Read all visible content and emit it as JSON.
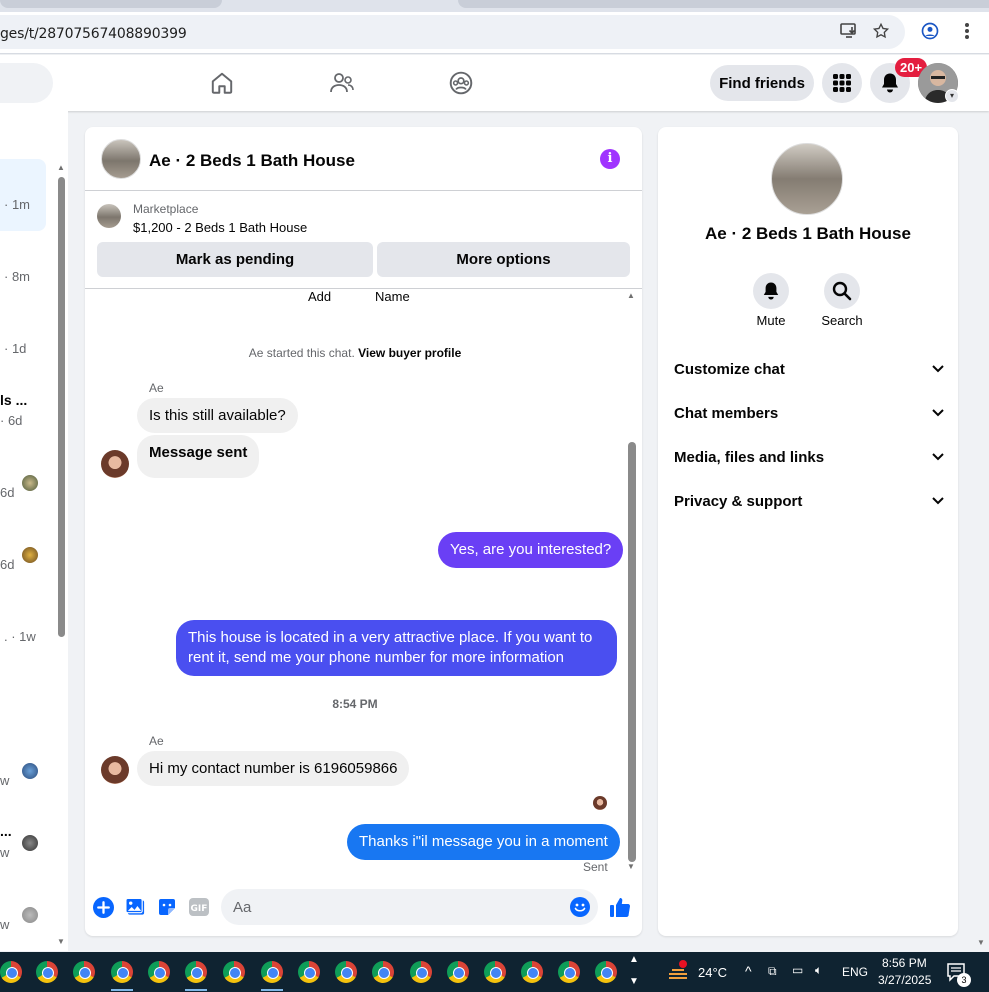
{
  "browser": {
    "url": "ges/t/28707567408890399"
  },
  "nav": {
    "find_friends": "Find friends",
    "notification_count": "20+"
  },
  "left_list": {
    "items": [
      {
        "time": "· 1m",
        "bold": ""
      },
      {
        "time": "· 8m",
        "bold": ""
      },
      {
        "time": "· 1d",
        "bold": ""
      },
      {
        "time": "· 6d",
        "bold": "ls ..."
      },
      {
        "time": "6d",
        "bold": ""
      },
      {
        "time": "6d",
        "bold": ""
      },
      {
        "time": ". · 1w",
        "bold": ""
      },
      {
        "time": "w",
        "bold": ""
      },
      {
        "time": "w",
        "bold": "..."
      },
      {
        "time": "w",
        "bold": ""
      }
    ]
  },
  "conversation": {
    "title": "Ae · 2 Beds 1 Bath House",
    "marketplace_label": "Marketplace",
    "listing": "$1,200 - 2 Beds 1 Bath House",
    "mark_pending": "Mark as pending",
    "more_options": "More options",
    "top_labels": {
      "add": "Add",
      "name": "Name"
    },
    "started_note": "Ae started this chat.",
    "view_buyer": "View buyer profile",
    "sender": "Ae",
    "messages": [
      {
        "text": "Is this still available?"
      },
      {
        "text": "Message sent"
      },
      {
        "text": "Yes, are you interested?"
      },
      {
        "text": "This house is located in a very attractive place. If you want to rent it, send me your phone number for more information"
      },
      {
        "text": "Hi my contact number is 6196059866"
      },
      {
        "text": "Thanks i\"il message you in a moment"
      }
    ],
    "time_separator": "8:54 PM",
    "sent_status": "Sent",
    "composer_placeholder": "Aa"
  },
  "info_panel": {
    "title": "Ae · 2 Beds 1 Bath House",
    "mute": "Mute",
    "search": "Search",
    "sections": [
      "Customize chat",
      "Chat members",
      "Media, files and links",
      "Privacy & support"
    ]
  },
  "taskbar": {
    "temperature": "24°C",
    "language": "ENG",
    "time": "8:56 PM",
    "date": "3/27/2025",
    "notifications": "3"
  },
  "colors": {
    "accent_purple": "#a033ff",
    "bubble_out_1": "#6a3ff5",
    "bubble_out_2": "#4a4ff0",
    "bubble_out_3": "#1877f2",
    "fb_blue": "#0866ff"
  }
}
